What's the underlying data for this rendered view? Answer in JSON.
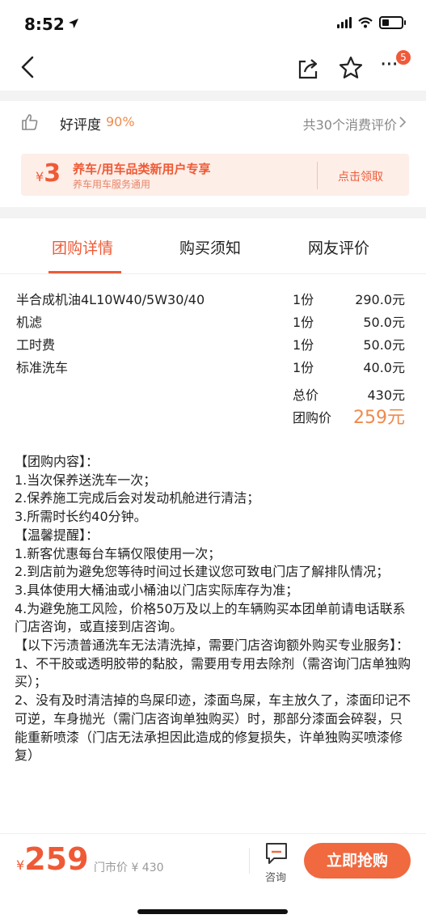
{
  "status_bar": {
    "time": "8:52"
  },
  "nav": {
    "badge_count": "5"
  },
  "rating": {
    "label": "好评度",
    "value": "90%",
    "reviews_text": "共30个消费评价"
  },
  "coupon": {
    "yen": "¥",
    "amount": "3",
    "title": "养车/用车品类新用户专享",
    "subtitle": "养车用车服务通用",
    "action": "点击领取"
  },
  "tabs": [
    {
      "label": "团购详情",
      "active": true
    },
    {
      "label": "购买须知",
      "active": false
    },
    {
      "label": "网友评价",
      "active": false
    }
  ],
  "items": [
    {
      "name": "半合成机油4L10W40/5W30/40",
      "qty": "1份",
      "price": "290.0元"
    },
    {
      "name": "机滤",
      "qty": "1份",
      "price": "50.0元"
    },
    {
      "name": "工时费",
      "qty": "1份",
      "price": "50.0元"
    },
    {
      "name": "标准洗车",
      "qty": "1份",
      "price": "40.0元"
    }
  ],
  "summary": {
    "total_label": "总价",
    "total_value": "430元",
    "group_label": "团购价",
    "group_value": "259元"
  },
  "description": [
    "【团购内容】：",
    "1.当次保养送洗车一次；",
    "2.保养施工完成后会对发动机舱进行清洁；",
    "3.所需时长约40分钟。",
    "【温馨提醒】：",
    "1.新客优惠每台车辆仅限使用一次；",
    "2.到店前为避免您等待时间过长建议您可致电门店了解排队情况；",
    "3.具体使用大桶油或小桶油以门店实际库存为准；",
    "4.为避免施工风险，价格50万及以上的车辆购买本团单前请电话联系门店咨询，或直接到店咨询。",
    "【以下污渍普通洗车无法清洗掉，需要门店咨询额外购买专业服务】：",
    "1、不干胶或透明胶带的黏胶，需要用专用去除剂（需咨询门店单独购买）；",
    "2、没有及时清洁掉的鸟屎印迹，漆面鸟屎，车主放久了，漆面印记不可逆，车身抛光（需门店咨询单独购买）时，那部分漆面会碎裂，只能重新喷漆（门店无法承担因此造成的修复损失，许单独购买喷漆修复）"
  ],
  "bottom_bar": {
    "yen": "¥",
    "price": "259",
    "market_price": "门市价 ¥ 430",
    "consult_label": "咨询",
    "buy_label": "立即抢购"
  },
  "colors": {
    "accent": "#ef5a36",
    "price_orange": "#f08a4b"
  }
}
